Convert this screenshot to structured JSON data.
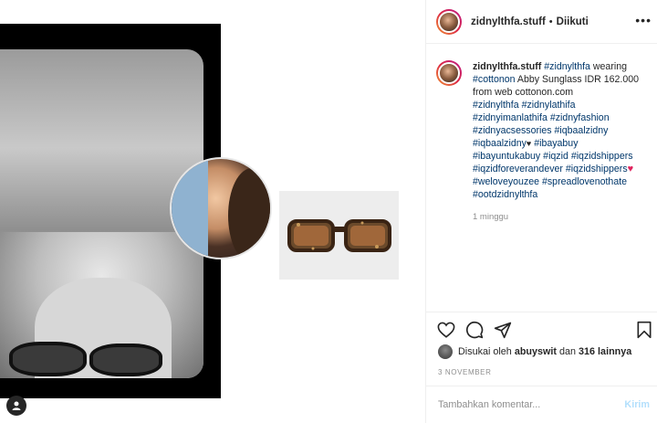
{
  "post": {
    "username": "zidnylthfa.stuff",
    "separator": "•",
    "follow_status": "Diikuti",
    "more_icon": "more-horizontal-icon"
  },
  "caption": {
    "username": "zidnylthfa.stuff",
    "mention": "#zidnylthfa",
    "text1": " wearing ",
    "tag_cottonon": "#cottonon",
    "text2": " Abby Sunglass IDR 162.000 from web cottonon.com",
    "hashtags": [
      "#zidnylthfa",
      "#zidnylathifa",
      "#zidnyimanlathifa",
      "#zidnyfashion",
      "#zidnyacsessories",
      "#iqbaalzidny",
      "#iqbaalzidny",
      "#ibayabuy",
      "#ibayuntukabuy",
      "#iqzid",
      "#iqzidshippers",
      "#iqzidforeverandever",
      "#iqzidshippers",
      "#weloveyouzee",
      "#spreadlovenothate",
      "#ootdzidnylthfa"
    ],
    "time_ago": "1 minggu"
  },
  "likes": {
    "prefix": "Disukai oleh",
    "user": "abuyswit",
    "connector": "dan",
    "others": "316 lainnya"
  },
  "date": "3 NOVEMBER",
  "comment_box": {
    "placeholder": "Tambahkan komentar...",
    "post_label": "Kirim"
  },
  "colors": {
    "link": "#00376b",
    "muted": "#8e8e8e",
    "post_disabled": "#b2dffc"
  }
}
